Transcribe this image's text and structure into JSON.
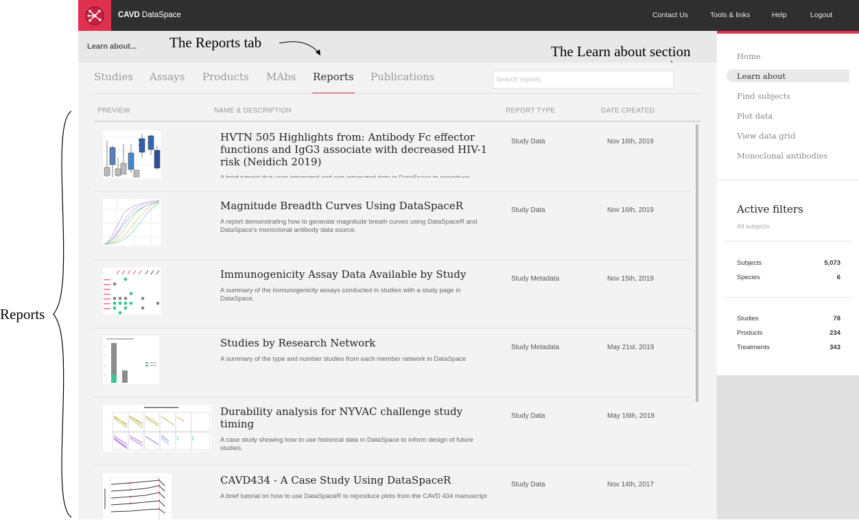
{
  "annotations": {
    "reports_tab": "The Reports tab",
    "learn_about_section": "The Learn about section",
    "reports": "Reports"
  },
  "app": {
    "brand_bold": "CAVD",
    "brand_rest": " DataSpace",
    "nav": [
      "Contact Us",
      "Tools & links",
      "Help",
      "Logout"
    ]
  },
  "learn_bar": {
    "label": "Learn about..."
  },
  "tabs": [
    "Studies",
    "Assays",
    "Products",
    "MAbs",
    "Reports",
    "Publications"
  ],
  "active_tab": "Reports",
  "search": {
    "placeholder": "Search reports"
  },
  "columns": [
    "PREVIEW",
    "NAME & DESCRIPTION",
    "REPORT TYPE",
    "DATE CREATED"
  ],
  "reports": [
    {
      "title": "HVTN 505 Highlights from: Antibody Fc effector functions and IgG3 associate with decreased HIV-1 risk (Neidich 2019)",
      "description": "A brief tutorial that uses integrated and non-integrated data in DataSpace to reproduce",
      "type": "Study Data",
      "date": "Nov 16th, 2019"
    },
    {
      "title": "Magnitude Breadth Curves Using DataSpaceR",
      "description": "A report demonstrating how to generate magnitude breath curves using DataSpaceR and DataSpace's monoclonal antibody data source.",
      "type": "Study Data",
      "date": "Nov 16th, 2019"
    },
    {
      "title": "Immunogenicity Assay Data Available by Study",
      "description": "A summary of the immunogenicity assays conducted in studies with a study page in DataSpace.",
      "type": "Study Metadata",
      "date": "Nov 15th, 2019"
    },
    {
      "title": "Studies by Research Network",
      "description": "A summary of the type and number studies from each member network in DataSpace",
      "type": "Study Metadata",
      "date": "May 21st, 2019"
    },
    {
      "title": "Durability analysis for NYVAC challenge study timing",
      "description": "A case study showing how to use historical data in DataSpace to inform design of future studies.",
      "type": "Study Data",
      "date": "May 16th, 2018"
    },
    {
      "title": "CAVD434 - A Case Study Using DataSpaceR",
      "description": "A brief tutorial on how to use DataSpaceR to reproduce plots from the CAVD 434 manuscript",
      "type": "Study Data",
      "date": "Nov 14th, 2017"
    }
  ],
  "sidebar": {
    "links": [
      "Home",
      "Learn about",
      "Find subjects",
      "Plot data",
      "View data grid",
      "Monoclonal antibodies"
    ],
    "active_link": "Learn about",
    "active_filters": {
      "title": "Active filters",
      "subtitle": "All subjects",
      "group1": [
        {
          "label": "Subjects",
          "value": "5,073"
        },
        {
          "label": "Species",
          "value": "6"
        }
      ],
      "group2": [
        {
          "label": "Studies",
          "value": "78"
        },
        {
          "label": "Products",
          "value": "234"
        },
        {
          "label": "Treatments",
          "value": "343"
        }
      ]
    }
  }
}
